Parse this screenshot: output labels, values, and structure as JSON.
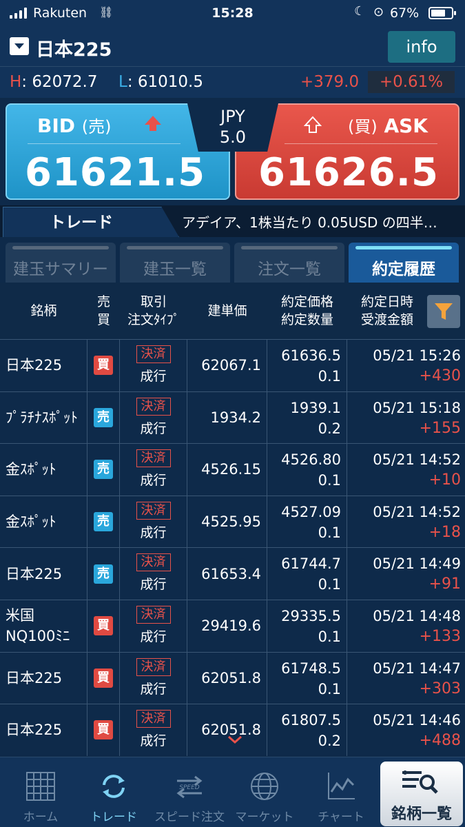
{
  "status": {
    "carrier": "Rakuten",
    "time": "15:28",
    "battery": "67%"
  },
  "header": {
    "title": "日本225",
    "info_label": "info"
  },
  "range": {
    "h_key": "H",
    "high": ": 62072.7",
    "l_key": "L",
    "low": ": 61010.5",
    "change": "+379.0",
    "change_pct": "+0.61%"
  },
  "bid": {
    "label": "BID",
    "side": "(売)",
    "price": "61621.5"
  },
  "ask": {
    "label": "ASK",
    "side": "(買)",
    "price": "61626.5"
  },
  "spread": {
    "currency": "JPY",
    "value": "5.0"
  },
  "trade_tab": "トレード",
  "news_ticker": "アデイア、1株当たり 0.05USD の四半…",
  "subtabs": [
    "建玉サマリー",
    "建玉一覧",
    "注文一覧",
    "約定履歴"
  ],
  "table": {
    "headers": {
      "symbol": "銘柄",
      "side1": "売",
      "side2": "買",
      "type1": "取引",
      "type2": "注文ﾀｲﾌﾟ",
      "entry": "建単価",
      "price1": "約定価格",
      "price2": "約定数量",
      "date1": "約定日時",
      "date2": "受渡金額"
    },
    "rows": [
      {
        "name": "日本225",
        "side": "買",
        "trade": "決済",
        "order": "成行",
        "entry": "62067.1",
        "price": "61636.5",
        "qty": "0.1",
        "datetime": "05/21 15:26",
        "pl": "+430"
      },
      {
        "name": "ﾌﾟﾗﾁﾅｽﾎﾟｯﾄ",
        "side": "売",
        "trade": "決済",
        "order": "成行",
        "entry": "1934.2",
        "price": "1939.1",
        "qty": "0.2",
        "datetime": "05/21 15:18",
        "pl": "+155"
      },
      {
        "name": "金ｽﾎﾟｯﾄ",
        "side": "売",
        "trade": "決済",
        "order": "成行",
        "entry": "4526.15",
        "price": "4526.80",
        "qty": "0.1",
        "datetime": "05/21 14:52",
        "pl": "+10"
      },
      {
        "name": "金ｽﾎﾟｯﾄ",
        "side": "売",
        "trade": "決済",
        "order": "成行",
        "entry": "4525.95",
        "price": "4527.09",
        "qty": "0.1",
        "datetime": "05/21 14:52",
        "pl": "+18"
      },
      {
        "name": "日本225",
        "side": "売",
        "trade": "決済",
        "order": "成行",
        "entry": "61653.4",
        "price": "61744.7",
        "qty": "0.1",
        "datetime": "05/21 14:49",
        "pl": "+91"
      },
      {
        "name": "米国 NQ100ﾐﾆ",
        "side": "買",
        "trade": "決済",
        "order": "成行",
        "entry": "29419.6",
        "price": "29335.5",
        "qty": "0.1",
        "datetime": "05/21 14:48",
        "pl": "+133"
      },
      {
        "name": "日本225",
        "side": "買",
        "trade": "決済",
        "order": "成行",
        "entry": "62051.8",
        "price": "61748.5",
        "qty": "0.1",
        "datetime": "05/21 14:47",
        "pl": "+303"
      },
      {
        "name": "日本225",
        "side": "買",
        "trade": "決済",
        "order": "成行",
        "entry": "62051.8",
        "price": "61807.5",
        "qty": "0.2",
        "datetime": "05/21 14:46",
        "pl": "+488"
      }
    ]
  },
  "tabbar": [
    "ホーム",
    "トレード",
    "スピード注文",
    "マーケット",
    "チャート",
    "銘柄一覧"
  ],
  "colors": {
    "bid": "#2aa7dc",
    "ask": "#e04a42",
    "profit": "#e8524a",
    "bg": "#0e2a4a"
  }
}
